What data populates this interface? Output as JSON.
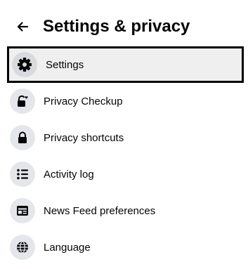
{
  "header": {
    "back_icon": "arrow-left-icon",
    "title": "Settings & privacy"
  },
  "menu": {
    "items": [
      {
        "label": "Settings",
        "icon": "gear-icon",
        "selected": true
      },
      {
        "label": "Privacy Checkup",
        "icon": "lock-heart-icon"
      },
      {
        "label": "Privacy shortcuts",
        "icon": "lock-icon"
      },
      {
        "label": "Activity log",
        "icon": "list-icon"
      },
      {
        "label": "News Feed preferences",
        "icon": "feed-icon"
      },
      {
        "label": "Language",
        "icon": "globe-icon"
      }
    ]
  },
  "colors": {
    "text": "#050505",
    "icon_bg": "#e4e6eb",
    "selected_bg": "#efefef",
    "selected_border": "#000000"
  }
}
